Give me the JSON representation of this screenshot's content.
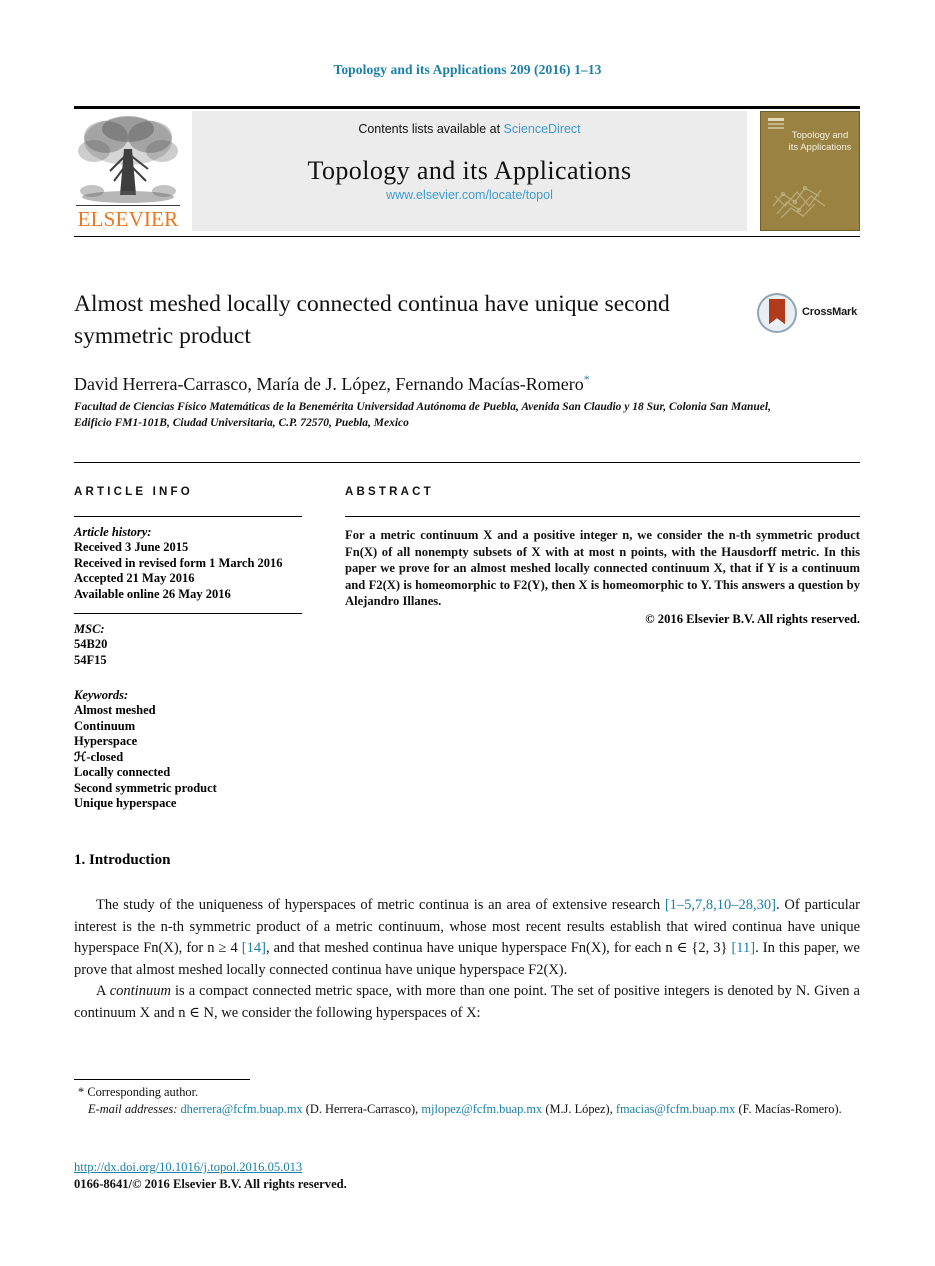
{
  "running_head": "Topology and its Applications 209 (2016) 1–13",
  "masthead": {
    "publisher_name": "ELSEVIER",
    "contents_prefix": "Contents lists available at",
    "contents_link": "ScienceDirect",
    "journal_title": "Topology and its Applications",
    "journal_url": "www.elsevier.com/locate/topol",
    "cover_title": "Topology and its Applications",
    "accent_link_color": "#3e9bd1",
    "elsevier_orange": "#e87722",
    "cover_color": "#9a8342"
  },
  "article": {
    "title": "Almost meshed locally connected continua have unique second symmetric product",
    "crossmark_label": "CrossMark",
    "authors": "David Herrera-Carrasco, María de J. López, Fernando Macías-Romero",
    "corresponding_marker": "*",
    "affiliation": "Facultad de Ciencias Físico Matemáticas de la Benemérita Universidad Autónoma de Puebla, Avenida San Claudio y 18 Sur, Colonia San Manuel, Edificio FM1-101B, Ciudad Universitaria, C.P. 72570, Puebla, Mexico"
  },
  "info": {
    "heading": "ARTICLE INFO",
    "history_label": "Article history:",
    "history": [
      "Received 3 June 2015",
      "Received in revised form 1 March 2016",
      "Accepted 21 May 2016",
      "Available online 26 May 2016"
    ],
    "msc_label": "MSC:",
    "msc": [
      "54B20",
      "54F15"
    ],
    "keywords_label": "Keywords:",
    "keywords": [
      "Almost meshed",
      "Continuum",
      "Hyperspace",
      "ℋ-closed",
      "Locally connected",
      "Second symmetric product",
      "Unique hyperspace"
    ]
  },
  "abstract": {
    "heading": "ABSTRACT",
    "text": "For a metric continuum X and a positive integer n, we consider the n-th symmetric product Fn(X) of all nonempty subsets of X with at most n points, with the Hausdorff metric. In this paper we prove for an almost meshed locally connected continuum X, that if Y is a continuum and F2(X) is homeomorphic to F2(Y), then X is homeomorphic to Y. This answers a question by Alejandro Illanes.",
    "copyright": "© 2016 Elsevier B.V. All rights reserved."
  },
  "body": {
    "section_number_title": "1. Introduction",
    "paragraph1_a": "The study of the uniqueness of hyperspaces of metric continua is an area of extensive research ",
    "paragraph1_ref1": "[1–5,7,8,10–28,30]",
    "paragraph1_b": ". Of particular interest is the n-th symmetric product of a metric continuum, whose most recent results establish that wired continua have unique hyperspace Fn(X), for n ≥ 4 ",
    "paragraph1_ref2": "[14]",
    "paragraph1_c": ", and that meshed continua have unique hyperspace Fn(X), for each n ∈ {2, 3} ",
    "paragraph1_ref3": "[11]",
    "paragraph1_d": ". In this paper, we prove that almost meshed locally connected continua have unique hyperspace F2(X).",
    "paragraph2_a": "A ",
    "paragraph2_em": "continuum",
    "paragraph2_b": " is a compact connected metric space, with more than one point. The set of positive integers is denoted by N. Given a continuum X and n ∈ N, we consider the following hyperspaces of X:"
  },
  "footnote": {
    "corresponding_marker": "*",
    "corresponding_text": "Corresponding author.",
    "email_label": "E-mail addresses:",
    "emails": [
      {
        "address": "dherrera@fcfm.buap.mx",
        "owner": "(D. Herrera-Carrasco),"
      },
      {
        "address": "mjlopez@fcfm.buap.mx",
        "owner": "(M.J. López),"
      },
      {
        "address": "fmacias@fcfm.buap.mx",
        "owner": "(F. Macías-Romero)."
      }
    ],
    "doi": "http://dx.doi.org/10.1016/j.topol.2016.05.013",
    "issn_line": "0166-8641/© 2016 Elsevier B.V. All rights reserved."
  }
}
